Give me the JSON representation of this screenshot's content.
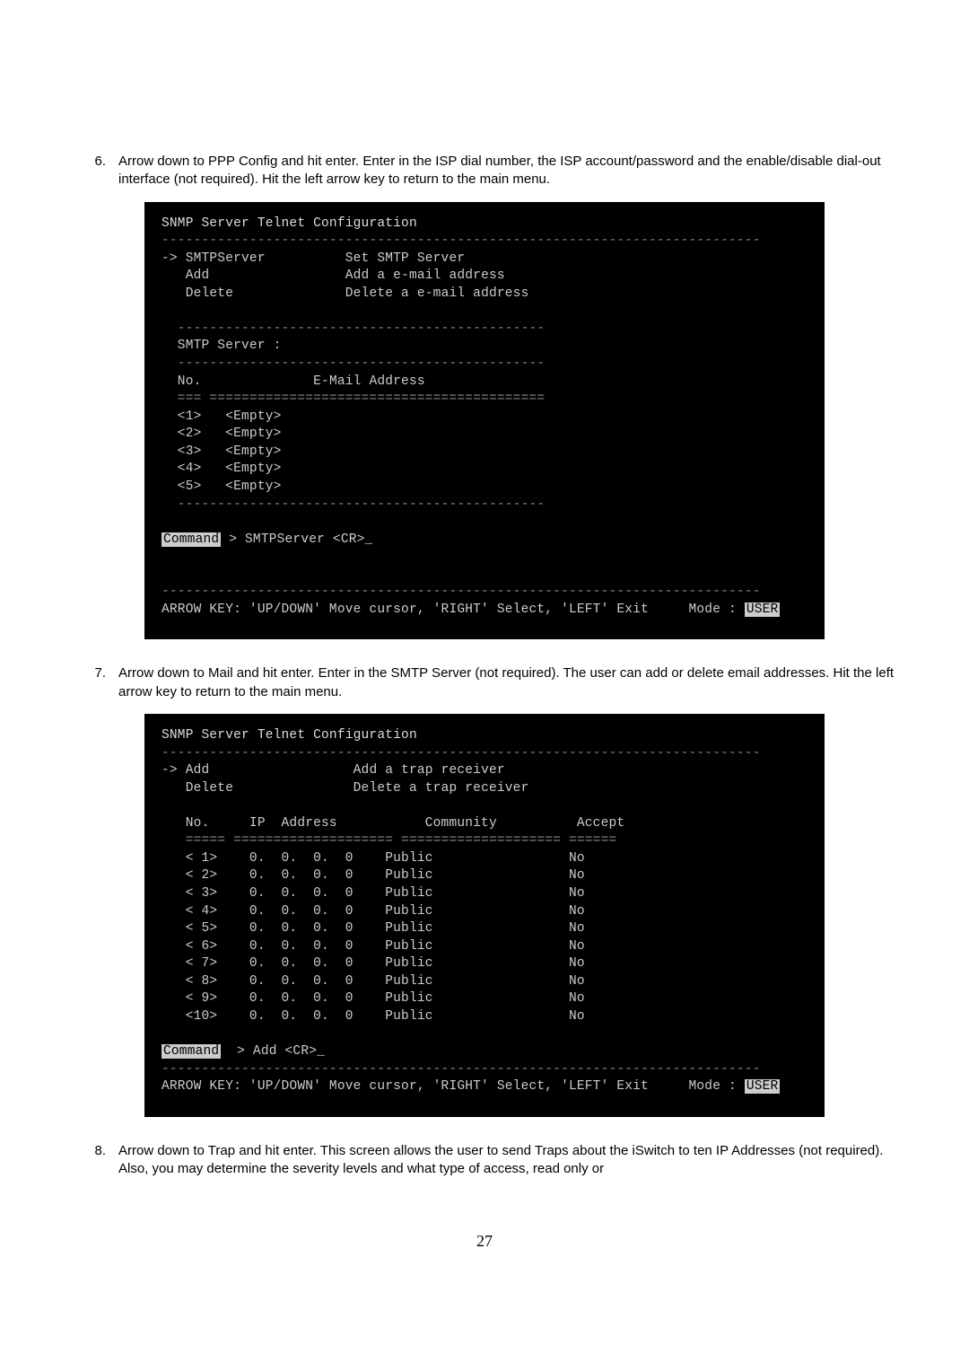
{
  "steps": {
    "s6": {
      "num": "6.",
      "text": "Arrow down to PPP Config and hit enter.  Enter in the ISP dial number, the ISP account/password and the enable/disable dial-out interface (not required).  Hit the left arrow key to return to the main menu."
    },
    "s7": {
      "num": "7.",
      "text": "Arrow down to Mail and hit enter.  Enter in the SMTP Server (not required).  The user can add or delete email addresses.  Hit the left arrow key to return to the main menu."
    },
    "s8": {
      "num": "8.",
      "text": "Arrow down to Trap and hit enter.  This screen allows the user to send Traps about the iSwitch to ten IP Addresses (not required).  Also, you may determine the severity levels and what type of access, read only or"
    }
  },
  "term1": {
    "title": "SNMP Server Telnet Configuration",
    "dash_long": "---------------------------------------------------------------------------",
    "m1a": "-> SMTPServer",
    "m1b": "Set SMTP Server",
    "m2a": "   Add",
    "m2b": "Add a e-mail address",
    "m3a": "   Delete",
    "m3b": "Delete a e-mail address",
    "dash_mid": "  ----------------------------------------------",
    "smtp_label": "  SMTP Server :",
    "hdr_no": "  No.",
    "hdr_addr": "E-Mail Address",
    "eq_line": "  === ==========================================",
    "r1": "  <1>   <Empty>",
    "r2": "  <2>   <Empty>",
    "r3": "  <3>   <Empty>",
    "r4": "  <4>   <Empty>",
    "r5": "  <5>   <Empty>",
    "cmd_label": "Command",
    "cmd_rest": " > SMTPServer <CR>_",
    "footer_a": "ARROW KEY: 'UP/DOWN' Move cursor, 'RIGHT' Select, 'LEFT' Exit     Mode : ",
    "footer_mode": "USER"
  },
  "term2": {
    "title": "SNMP Server Telnet Configuration",
    "dash_long": "---------------------------------------------------------------------------",
    "m1a": "-> Add",
    "m1b": "Add a trap receiver",
    "m2a": "   Delete",
    "m2b": "Delete a trap receiver",
    "hdr": "   No.     IP  Address           Community          Accept",
    "eq": "   ===== ==================== ==================== ======",
    "rows": [
      "   < 1>    0.  0.  0.  0    Public                 No",
      "   < 2>    0.  0.  0.  0    Public                 No",
      "   < 3>    0.  0.  0.  0    Public                 No",
      "   < 4>    0.  0.  0.  0    Public                 No",
      "   < 5>    0.  0.  0.  0    Public                 No",
      "   < 6>    0.  0.  0.  0    Public                 No",
      "   < 7>    0.  0.  0.  0    Public                 No",
      "   < 8>    0.  0.  0.  0    Public                 No",
      "   < 9>    0.  0.  0.  0    Public                 No",
      "   <10>    0.  0.  0.  0    Public                 No"
    ],
    "cmd_label": "Command",
    "cmd_rest": "  > Add <CR>_",
    "footer_a": "ARROW KEY: 'UP/DOWN' Move cursor, 'RIGHT' Select, 'LEFT' Exit     Mode : ",
    "footer_mode": "USER"
  },
  "page_number": "27"
}
